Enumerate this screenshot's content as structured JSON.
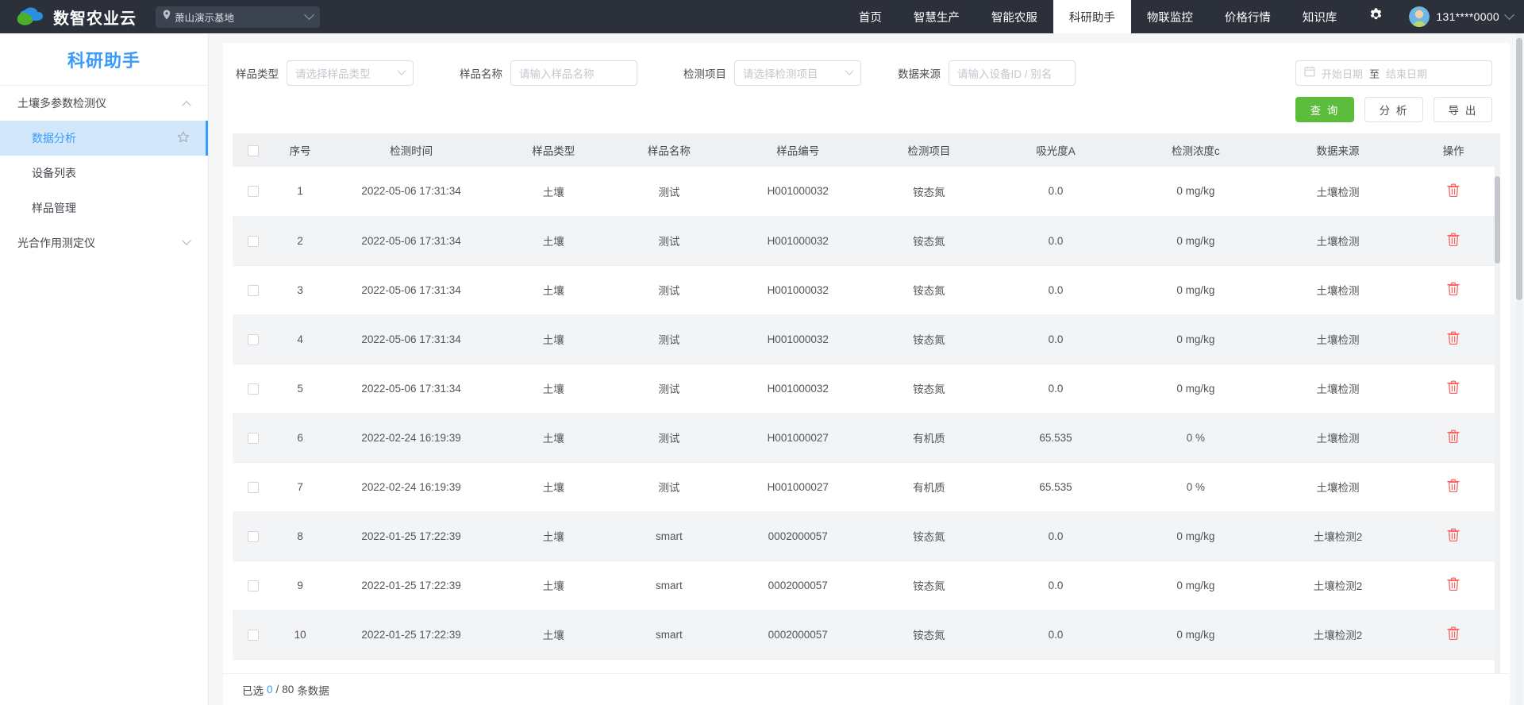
{
  "topbar": {
    "brand_title": "数智农业云",
    "logo_icon": "cloud-leaf-logo",
    "site_selector": {
      "pin_icon": "location-pin-icon",
      "value": "萧山演示基地",
      "chevron_icon": "chevron-down-icon"
    },
    "nav_items": [
      {
        "label": "首页",
        "active": false
      },
      {
        "label": "智慧生产",
        "active": false
      },
      {
        "label": "智能农服",
        "active": false
      },
      {
        "label": "科研助手",
        "active": true
      },
      {
        "label": "物联监控",
        "active": false
      },
      {
        "label": "价格行情",
        "active": false
      },
      {
        "label": "知识库",
        "active": false
      }
    ],
    "gear_icon": "gear-icon",
    "avatar_icon": "user-avatar",
    "user_phone": "131****0000",
    "user_chevron_icon": "chevron-down-icon"
  },
  "sidebar": {
    "title": "科研助手",
    "groups": [
      {
        "label": "土壤多参数检测仪",
        "expanded": true,
        "caret_icon": "chevron-up-icon",
        "items": [
          {
            "label": "数据分析",
            "active": true,
            "star_icon": "star-outline-icon"
          },
          {
            "label": "设备列表",
            "active": false
          },
          {
            "label": "样品管理",
            "active": false
          }
        ]
      },
      {
        "label": "光合作用测定仪",
        "expanded": false,
        "caret_icon": "chevron-down-icon",
        "items": []
      }
    ]
  },
  "filters": {
    "sample_type": {
      "label": "样品类型",
      "placeholder": "请选择样品类型",
      "value": "",
      "chevron_icon": "chevron-down-icon"
    },
    "sample_name": {
      "label": "样品名称",
      "placeholder": "请输入样品名称",
      "value": ""
    },
    "test_item": {
      "label": "检测项目",
      "placeholder": "请选择检测项目",
      "value": "",
      "chevron_icon": "chevron-down-icon"
    },
    "data_source": {
      "label": "数据来源",
      "placeholder": "请输入设备ID / 别名",
      "value": ""
    },
    "date_range": {
      "calendar_icon": "calendar-icon",
      "start_placeholder": "开始日期",
      "separator": "至",
      "end_placeholder": "结束日期"
    }
  },
  "actions": {
    "query_label": "查 询",
    "analyze_label": "分 析",
    "export_label": "导 出",
    "primary_color": "#5bbd3b"
  },
  "table": {
    "select_all_icon": "checkbox-unchecked-icon",
    "columns": [
      "序号",
      "检测时间",
      "样品类型",
      "样品名称",
      "样品编号",
      "检测项目",
      "吸光度A",
      "检测浓度c",
      "数据来源",
      "操作"
    ],
    "row_checkbox_icon": "checkbox-unchecked-icon",
    "row_delete_icon": "trash-icon",
    "delete_icon_color": "#fa6464",
    "rows": [
      {
        "index": "1",
        "time": "2022-05-06 17:31:34",
        "sample_type": "土壤",
        "sample_name": "测试",
        "sample_no": "H001000032",
        "test_item": "铵态氮",
        "absorbance": "0.0",
        "concentration": "0 mg/kg",
        "source": "土壤检测"
      },
      {
        "index": "2",
        "time": "2022-05-06 17:31:34",
        "sample_type": "土壤",
        "sample_name": "测试",
        "sample_no": "H001000032",
        "test_item": "铵态氮",
        "absorbance": "0.0",
        "concentration": "0 mg/kg",
        "source": "土壤检测"
      },
      {
        "index": "3",
        "time": "2022-05-06 17:31:34",
        "sample_type": "土壤",
        "sample_name": "测试",
        "sample_no": "H001000032",
        "test_item": "铵态氮",
        "absorbance": "0.0",
        "concentration": "0 mg/kg",
        "source": "土壤检测"
      },
      {
        "index": "4",
        "time": "2022-05-06 17:31:34",
        "sample_type": "土壤",
        "sample_name": "测试",
        "sample_no": "H001000032",
        "test_item": "铵态氮",
        "absorbance": "0.0",
        "concentration": "0 mg/kg",
        "source": "土壤检测"
      },
      {
        "index": "5",
        "time": "2022-05-06 17:31:34",
        "sample_type": "土壤",
        "sample_name": "测试",
        "sample_no": "H001000032",
        "test_item": "铵态氮",
        "absorbance": "0.0",
        "concentration": "0 mg/kg",
        "source": "土壤检测"
      },
      {
        "index": "6",
        "time": "2022-02-24 16:19:39",
        "sample_type": "土壤",
        "sample_name": "测试",
        "sample_no": "H001000027",
        "test_item": "有机质",
        "absorbance": "65.535",
        "concentration": "0 %",
        "source": "土壤检测"
      },
      {
        "index": "7",
        "time": "2022-02-24 16:19:39",
        "sample_type": "土壤",
        "sample_name": "测试",
        "sample_no": "H001000027",
        "test_item": "有机质",
        "absorbance": "65.535",
        "concentration": "0 %",
        "source": "土壤检测"
      },
      {
        "index": "8",
        "time": "2022-01-25 17:22:39",
        "sample_type": "土壤",
        "sample_name": "smart",
        "sample_no": "0002000057",
        "test_item": "铵态氮",
        "absorbance": "0.0",
        "concentration": "0 mg/kg",
        "source": "土壤检测2"
      },
      {
        "index": "9",
        "time": "2022-01-25 17:22:39",
        "sample_type": "土壤",
        "sample_name": "smart",
        "sample_no": "0002000057",
        "test_item": "铵态氮",
        "absorbance": "0.0",
        "concentration": "0 mg/kg",
        "source": "土壤检测2"
      },
      {
        "index": "10",
        "time": "2022-01-25 17:22:39",
        "sample_type": "土壤",
        "sample_name": "smart",
        "sample_no": "0002000057",
        "test_item": "铵态氮",
        "absorbance": "0.0",
        "concentration": "0 mg/kg",
        "source": "土壤检测2"
      }
    ]
  },
  "footer": {
    "prefix": "已选",
    "selected_count": "0",
    "divider": "/",
    "total_count": "80",
    "suffix": "条数据"
  }
}
